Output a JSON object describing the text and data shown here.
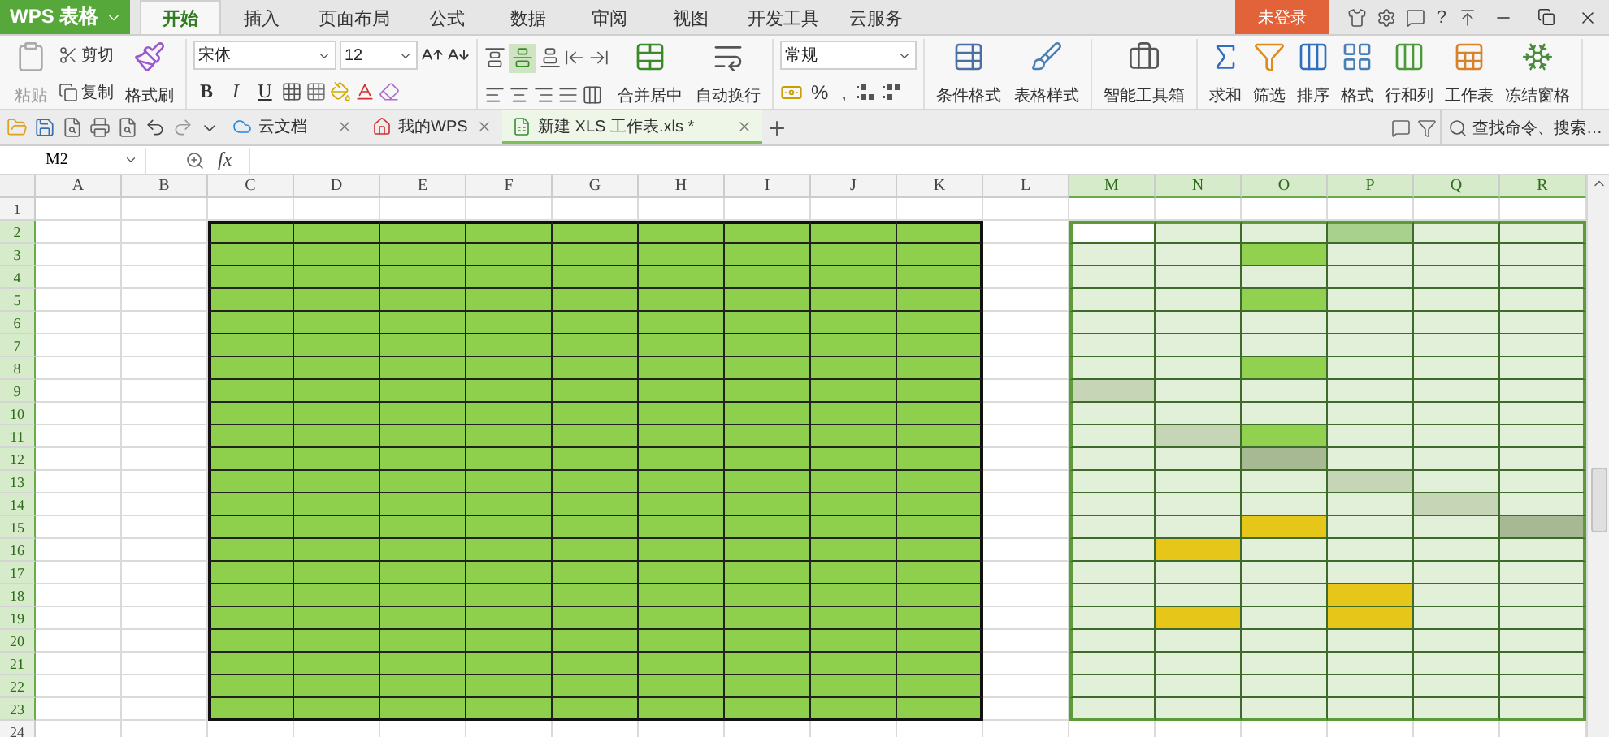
{
  "app": {
    "logo": "WPS 表格"
  },
  "menu_tabs": [
    {
      "label": "开始",
      "selected": true
    },
    {
      "label": "插入",
      "selected": false
    },
    {
      "label": "页面布局",
      "selected": false
    },
    {
      "label": "公式",
      "selected": false
    },
    {
      "label": "数据",
      "selected": false
    },
    {
      "label": "审阅",
      "selected": false
    },
    {
      "label": "视图",
      "selected": false
    },
    {
      "label": "开发工具",
      "selected": false
    },
    {
      "label": "云服务",
      "selected": false
    }
  ],
  "account": {
    "login": "未登录",
    "help": "?"
  },
  "ribbon": {
    "paste": {
      "label": "粘贴",
      "disabled": true
    },
    "cut": "剪切",
    "copy": "复制",
    "format_painter": "格式刷",
    "font": "宋体",
    "font_size": "12",
    "styles": [
      "B",
      "I",
      "U"
    ],
    "merge": "合并居中",
    "wrap": "自动换行",
    "number_format": "常规",
    "percent": "%",
    "comma": ",",
    "conditional_format": "条件格式",
    "table_style": "表格样式",
    "toolbox": "智能工具箱",
    "tools": [
      "求和",
      "筛选",
      "排序",
      "格式",
      "行和列",
      "工作表",
      "冻结窗格"
    ]
  },
  "doc_tabs": [
    {
      "label": "云文档",
      "kind": "cloud",
      "selected": false
    },
    {
      "label": "我的WPS",
      "kind": "home",
      "selected": false
    },
    {
      "label": "新建 XLS 工作表.xls *",
      "kind": "sheet",
      "selected": true
    }
  ],
  "search": {
    "placeholder": "查找命令、搜索…"
  },
  "formula_bar": {
    "cell": "M2",
    "fx": "fx"
  },
  "sheet": {
    "columns": [
      {
        "label": "A",
        "selected": false
      },
      {
        "label": "B",
        "selected": false
      },
      {
        "label": "C",
        "selected": false
      },
      {
        "label": "D",
        "selected": false
      },
      {
        "label": "E",
        "selected": false
      },
      {
        "label": "F",
        "selected": false
      },
      {
        "label": "G",
        "selected": false
      },
      {
        "label": "H",
        "selected": false
      },
      {
        "label": "I",
        "selected": false
      },
      {
        "label": "J",
        "selected": false
      },
      {
        "label": "K",
        "selected": false
      },
      {
        "label": "L",
        "selected": false
      },
      {
        "label": "M",
        "selected": true
      },
      {
        "label": "N",
        "selected": true
      },
      {
        "label": "O",
        "selected": true
      },
      {
        "label": "P",
        "selected": true
      },
      {
        "label": "Q",
        "selected": true
      },
      {
        "label": "R",
        "selected": true
      }
    ],
    "rows": [
      {
        "label": "1",
        "selected": false
      },
      {
        "label": "2",
        "selected": true
      },
      {
        "label": "3",
        "selected": true
      },
      {
        "label": "4",
        "selected": true
      },
      {
        "label": "5",
        "selected": true
      },
      {
        "label": "6",
        "selected": true
      },
      {
        "label": "7",
        "selected": true
      },
      {
        "label": "8",
        "selected": true
      },
      {
        "label": "9",
        "selected": true
      },
      {
        "label": "10",
        "selected": true
      },
      {
        "label": "11",
        "selected": true
      },
      {
        "label": "12",
        "selected": true
      },
      {
        "label": "13",
        "selected": true
      },
      {
        "label": "14",
        "selected": true
      },
      {
        "label": "15",
        "selected": true
      },
      {
        "label": "16",
        "selected": true
      },
      {
        "label": "17",
        "selected": true
      },
      {
        "label": "18",
        "selected": true
      },
      {
        "label": "19",
        "selected": true
      },
      {
        "label": "20",
        "selected": true
      },
      {
        "label": "21",
        "selected": true
      },
      {
        "label": "22",
        "selected": true
      },
      {
        "label": "23",
        "selected": true
      },
      {
        "label": "24",
        "selected": false
      }
    ],
    "block": {
      "color": "#8ed04b"
    },
    "shaded_rows": [
      {
        "cells": [
          {
            "color": "#ffffff"
          },
          {
            "color": "#e2efd9"
          },
          {
            "color": "#e2efd9"
          },
          {
            "color": "#a9d18e"
          },
          {
            "color": "#e2efd9"
          },
          {
            "color": "#e2efd9"
          }
        ]
      },
      {
        "cells": [
          {
            "color": "#e2efd9"
          },
          {
            "color": "#e2efd9"
          },
          {
            "color": "#92d050"
          },
          {
            "color": "#e2efd9"
          },
          {
            "color": "#e2efd9"
          },
          {
            "color": "#e2efd9"
          }
        ]
      },
      {
        "cells": [
          {
            "color": "#e2efd9"
          },
          {
            "color": "#e2efd9"
          },
          {
            "color": "#e2efd9"
          },
          {
            "color": "#e2efd9"
          },
          {
            "color": "#e2efd9"
          },
          {
            "color": "#e2efd9"
          }
        ]
      },
      {
        "cells": [
          {
            "color": "#e2efd9"
          },
          {
            "color": "#e2efd9"
          },
          {
            "color": "#92d050"
          },
          {
            "color": "#e2efd9"
          },
          {
            "color": "#e2efd9"
          },
          {
            "color": "#e2efd9"
          }
        ]
      },
      {
        "cells": [
          {
            "color": "#e2efd9"
          },
          {
            "color": "#e2efd9"
          },
          {
            "color": "#e2efd9"
          },
          {
            "color": "#e2efd9"
          },
          {
            "color": "#e2efd9"
          },
          {
            "color": "#e2efd9"
          }
        ]
      },
      {
        "cells": [
          {
            "color": "#e2efd9"
          },
          {
            "color": "#e2efd9"
          },
          {
            "color": "#e2efd9"
          },
          {
            "color": "#e2efd9"
          },
          {
            "color": "#e2efd9"
          },
          {
            "color": "#e2efd9"
          }
        ]
      },
      {
        "cells": [
          {
            "color": "#e2efd9"
          },
          {
            "color": "#e2efd9"
          },
          {
            "color": "#92d050"
          },
          {
            "color": "#e2efd9"
          },
          {
            "color": "#e2efd9"
          },
          {
            "color": "#e2efd9"
          }
        ]
      },
      {
        "cells": [
          {
            "color": "#c5d5b5"
          },
          {
            "color": "#e2efd9"
          },
          {
            "color": "#e2efd9"
          },
          {
            "color": "#e2efd9"
          },
          {
            "color": "#e2efd9"
          },
          {
            "color": "#e2efd9"
          }
        ]
      },
      {
        "cells": [
          {
            "color": "#e2efd9"
          },
          {
            "color": "#e2efd9"
          },
          {
            "color": "#e2efd9"
          },
          {
            "color": "#e2efd9"
          },
          {
            "color": "#e2efd9"
          },
          {
            "color": "#e2efd9"
          }
        ]
      },
      {
        "cells": [
          {
            "color": "#e2efd9"
          },
          {
            "color": "#c5d5b5"
          },
          {
            "color": "#92d050"
          },
          {
            "color": "#e2efd9"
          },
          {
            "color": "#e2efd9"
          },
          {
            "color": "#e2efd9"
          }
        ]
      },
      {
        "cells": [
          {
            "color": "#e2efd9"
          },
          {
            "color": "#e2efd9"
          },
          {
            "color": "#a6b993"
          },
          {
            "color": "#e2efd9"
          },
          {
            "color": "#e2efd9"
          },
          {
            "color": "#e2efd9"
          }
        ]
      },
      {
        "cells": [
          {
            "color": "#e2efd9"
          },
          {
            "color": "#e2efd9"
          },
          {
            "color": "#e2efd9"
          },
          {
            "color": "#c5d5b5"
          },
          {
            "color": "#e2efd9"
          },
          {
            "color": "#e2efd9"
          }
        ]
      },
      {
        "cells": [
          {
            "color": "#e2efd9"
          },
          {
            "color": "#e2efd9"
          },
          {
            "color": "#e2efd9"
          },
          {
            "color": "#e2efd9"
          },
          {
            "color": "#c5d5b5"
          },
          {
            "color": "#e2efd9"
          }
        ]
      },
      {
        "cells": [
          {
            "color": "#e2efd9"
          },
          {
            "color": "#e2efd9"
          },
          {
            "color": "#e6c619"
          },
          {
            "color": "#e2efd9"
          },
          {
            "color": "#e2efd9"
          },
          {
            "color": "#a6b993"
          }
        ]
      },
      {
        "cells": [
          {
            "color": "#e2efd9"
          },
          {
            "color": "#e6c619"
          },
          {
            "color": "#e2efd9"
          },
          {
            "color": "#e2efd9"
          },
          {
            "color": "#e2efd9"
          },
          {
            "color": "#e2efd9"
          }
        ]
      },
      {
        "cells": [
          {
            "color": "#e2efd9"
          },
          {
            "color": "#e2efd9"
          },
          {
            "color": "#e2efd9"
          },
          {
            "color": "#e2efd9"
          },
          {
            "color": "#e2efd9"
          },
          {
            "color": "#e2efd9"
          }
        ]
      },
      {
        "cells": [
          {
            "color": "#e2efd9"
          },
          {
            "color": "#e2efd9"
          },
          {
            "color": "#e2efd9"
          },
          {
            "color": "#e6c619"
          },
          {
            "color": "#e2efd9"
          },
          {
            "color": "#e2efd9"
          }
        ]
      },
      {
        "cells": [
          {
            "color": "#e2efd9"
          },
          {
            "color": "#e6c619"
          },
          {
            "color": "#e2efd9"
          },
          {
            "color": "#e6c619"
          },
          {
            "color": "#e2efd9"
          },
          {
            "color": "#e2efd9"
          }
        ]
      },
      {
        "cells": [
          {
            "color": "#e2efd9"
          },
          {
            "color": "#e2efd9"
          },
          {
            "color": "#e2efd9"
          },
          {
            "color": "#e2efd9"
          },
          {
            "color": "#e2efd9"
          },
          {
            "color": "#e2efd9"
          }
        ]
      },
      {
        "cells": [
          {
            "color": "#e2efd9"
          },
          {
            "color": "#e2efd9"
          },
          {
            "color": "#e2efd9"
          },
          {
            "color": "#e2efd9"
          },
          {
            "color": "#e2efd9"
          },
          {
            "color": "#e2efd9"
          }
        ]
      },
      {
        "cells": [
          {
            "color": "#e2efd9"
          },
          {
            "color": "#e2efd9"
          },
          {
            "color": "#e2efd9"
          },
          {
            "color": "#e2efd9"
          },
          {
            "color": "#e2efd9"
          },
          {
            "color": "#e2efd9"
          }
        ]
      },
      {
        "cells": [
          {
            "color": "#e2efd9"
          },
          {
            "color": "#e2efd9"
          },
          {
            "color": "#e2efd9"
          },
          {
            "color": "#e2efd9"
          },
          {
            "color": "#e2efd9"
          },
          {
            "color": "#e2efd9"
          }
        ]
      }
    ]
  }
}
